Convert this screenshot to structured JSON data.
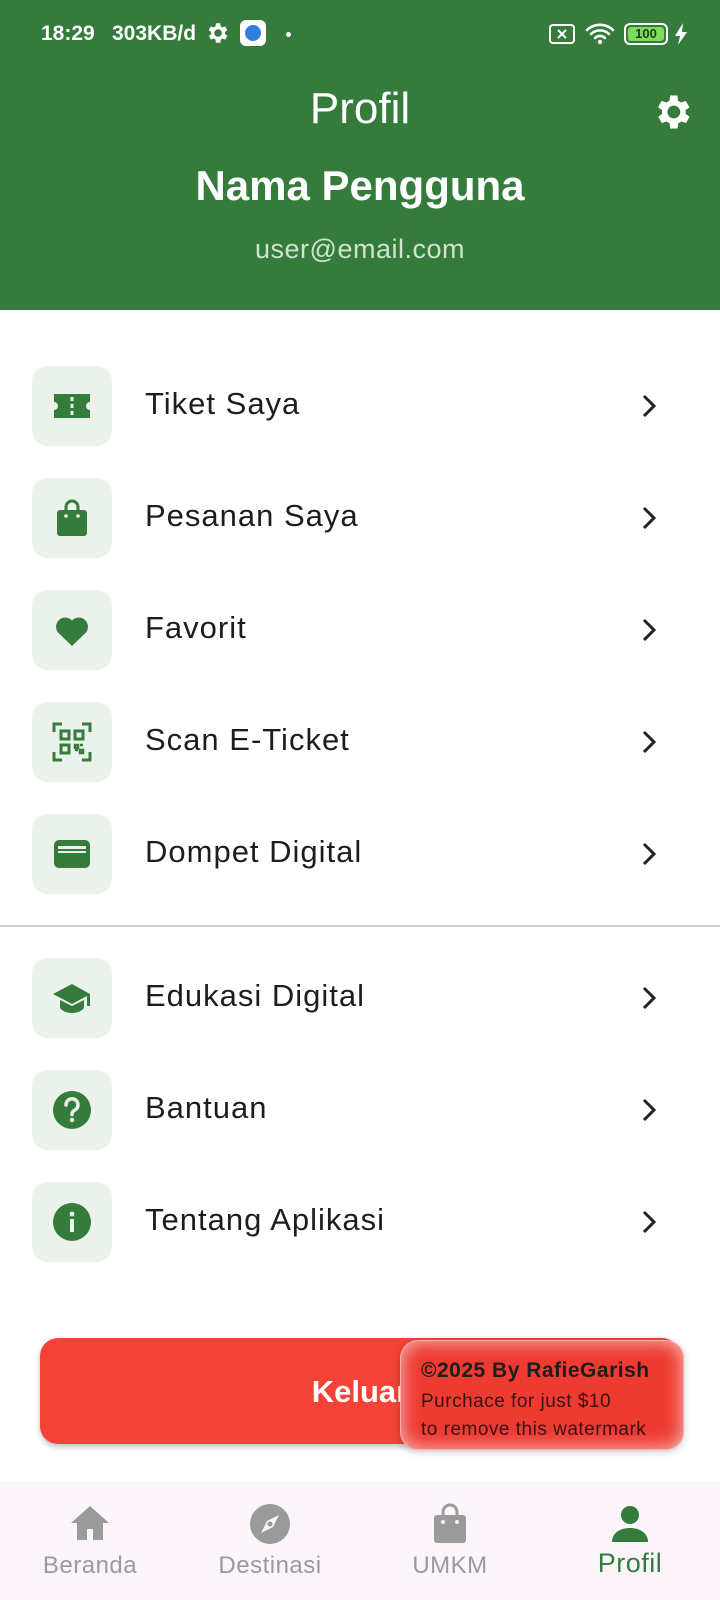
{
  "status_bar": {
    "time": "18:29",
    "speed": "303KB/d",
    "battery": "100"
  },
  "header": {
    "title": "Profil",
    "user_name": "Nama Pengguna",
    "user_email": "user@email.com"
  },
  "menu": {
    "group1": [
      {
        "label": "Tiket Saya",
        "icon": "ticket-icon"
      },
      {
        "label": "Pesanan Saya",
        "icon": "shopping-bag-icon"
      },
      {
        "label": "Favorit",
        "icon": "heart-icon"
      },
      {
        "label": "Scan E-Ticket",
        "icon": "qr-code-icon"
      },
      {
        "label": "Dompet Digital",
        "icon": "wallet-icon"
      }
    ],
    "group2": [
      {
        "label": "Edukasi Digital",
        "icon": "graduation-cap-icon"
      },
      {
        "label": "Bantuan",
        "icon": "help-icon"
      },
      {
        "label": "Tentang Aplikasi",
        "icon": "info-icon"
      }
    ]
  },
  "logout": {
    "label": "Keluar"
  },
  "watermark": {
    "line1": "©2025 By RafieGarish",
    "line2": "Purchace for just $10",
    "line3": "to remove this watermark"
  },
  "bottom_nav": [
    {
      "label": "Beranda",
      "icon": "home-icon"
    },
    {
      "label": "Destinasi",
      "icon": "compass-icon"
    },
    {
      "label": "UMKM",
      "icon": "shopping-bag-icon"
    },
    {
      "label": "Profil",
      "icon": "person-icon",
      "active": true
    }
  ],
  "colors": {
    "primary": "#357c3c",
    "logout": "#f44336",
    "icon_bg": "#ebf2eb",
    "nav_bg": "#fbf5fb",
    "nav_inactive": "#9a9a9a"
  }
}
